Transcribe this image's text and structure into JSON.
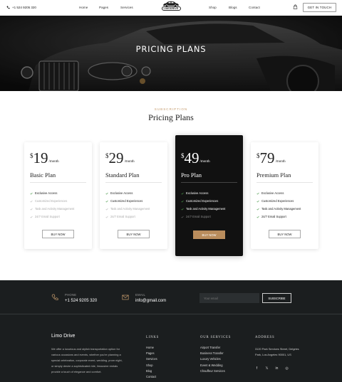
{
  "header": {
    "phone": "+1 524 9205 320",
    "nav": [
      "Home",
      "Pages",
      "Services",
      "Shop",
      "Blogs",
      "Contact"
    ],
    "logo_text": "LIMODRIVE",
    "cta": "GET IN TOUCH"
  },
  "hero": {
    "title": "PRICING PLANS"
  },
  "pricing": {
    "subtitle": "SUBSCRIPTION",
    "title": "Pricing Plans",
    "plans": [
      {
        "currency": "$",
        "price": "19",
        "period": "/month",
        "name": "Basic Plan",
        "features": [
          {
            "label": "Exclusive Access",
            "active": true
          },
          {
            "label": "Customized Experiences",
            "active": false
          },
          {
            "label": "Task and Activity Management",
            "active": false
          },
          {
            "label": "24/7 Email Support",
            "active": false
          }
        ],
        "button": "BUY NOW"
      },
      {
        "currency": "$",
        "price": "29",
        "period": "/month",
        "name": "Standard Plan",
        "features": [
          {
            "label": "Exclusive Access",
            "active": true
          },
          {
            "label": "Customized Experiences",
            "active": true
          },
          {
            "label": "Task and Activity Management",
            "active": false
          },
          {
            "label": "24/7 Email Support",
            "active": false
          }
        ],
        "button": "BUY NOW"
      },
      {
        "currency": "$",
        "price": "49",
        "period": "/month",
        "name": "Pro Plan",
        "features": [
          {
            "label": "Exclusive Access",
            "active": true
          },
          {
            "label": "Customized Experiences",
            "active": true
          },
          {
            "label": "Task and Activity Management",
            "active": true
          },
          {
            "label": "24/7 Email Support",
            "active": false
          }
        ],
        "button": "BUY NOW"
      },
      {
        "currency": "$",
        "price": "79",
        "period": "/month",
        "name": "Premium Plan",
        "features": [
          {
            "label": "Exclusive Access",
            "active": true
          },
          {
            "label": "Customized Experiences",
            "active": true
          },
          {
            "label": "Task and Activity Management",
            "active": true
          },
          {
            "label": "24/7 Email Support",
            "active": true
          }
        ],
        "button": "BUY NOW"
      }
    ]
  },
  "footer": {
    "phone_label": "PHONE",
    "phone_value": "+1 524 9205 320",
    "email_label": "EMAIL",
    "email_value": "info@gmail.com",
    "email_placeholder": "Your email",
    "subscribe": "SUBSCRIBE",
    "brand": "Limo Drive",
    "about": "We offer a luxurious and stylish transportation option for various occasions and events, whether you're planning a special celebration, corporate event, wedding, prom night, or simply desire a sophisticated ride, limousine rentals provide a touch of elegance and comfort.",
    "links_title": "LINKS",
    "links": [
      "Home",
      "Pages",
      "Services",
      "Shop",
      "Blog",
      "Contact"
    ],
    "services_title": "OUR SERVICES",
    "services": [
      "Airport Transfer",
      "Business Transfer",
      "Luxury Vehicles",
      "Event & Wedding",
      "Chauffeur Services"
    ],
    "address_title": "ADDRESS",
    "address": "3120 Park Services Street, Delgries Park, Los Angeles 90001, US",
    "socials": [
      "f",
      "𝕏",
      "in",
      "◎"
    ]
  },
  "colors": {
    "accent": "#b98c5c",
    "footer_bg": "#1b1e1f",
    "dark_card": "#111111"
  }
}
